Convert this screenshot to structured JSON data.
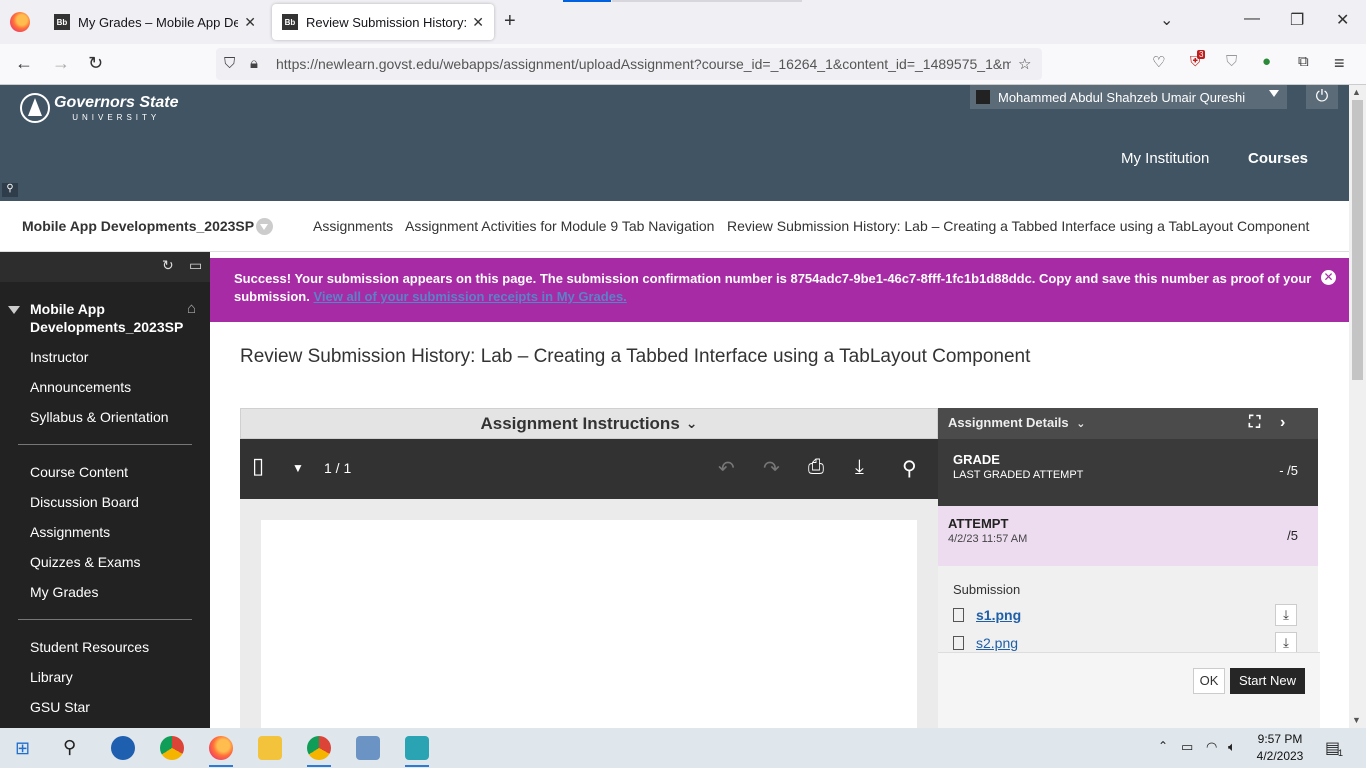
{
  "browser": {
    "tabs": [
      {
        "title": "My Grades – Mobile App Develo",
        "favicon": "Bb"
      },
      {
        "title": "Review Submission History: Lab",
        "favicon": "Bb"
      }
    ],
    "url": "https://newlearn.govst.edu/webapps/assignment/uploadAssignment?course_id=_16264_1&content_id=_1489575_1&m",
    "badge_count": "3"
  },
  "header": {
    "logo_name": "Governors State",
    "logo_sub": "UNIVERSITY",
    "user_name": "Mohammed Abdul Shahzeb Umair Qureshi",
    "nav": [
      "My Institution",
      "Courses"
    ]
  },
  "breadcrumbs": {
    "course": "Mobile App Developments_2023SP",
    "items": [
      "Assignments",
      "Assignment Activities for Module 9 Tab Navigation",
      "Review Submission History: Lab – Creating a Tabbed Interface using a TabLayout Component"
    ]
  },
  "sidebar": {
    "course_title_line1": "Mobile App",
    "course_title_line2": "Developments_2023SP",
    "group1": [
      "Instructor",
      "Announcements",
      "Syllabus & Orientation"
    ],
    "group2": [
      "Course Content",
      "Discussion Board",
      "Assignments",
      "Quizzes & Exams",
      "My Grades"
    ],
    "group3": [
      "Student Resources",
      "Library",
      "GSU Star"
    ]
  },
  "success": {
    "message": "Success! Your submission appears on this page. The submission confirmation number is 8754adc7-9be1-46c7-8fff-1fc1b1d88ddc. Copy and save this number as proof of your submission.",
    "link": "View all of your submission receipts in My Grades."
  },
  "page_title": "Review Submission History: Lab – Creating a Tabbed Interface using a TabLayout Component",
  "instructions": {
    "heading": "Assignment Instructions",
    "page_indicator": "1 / 1"
  },
  "details": {
    "heading": "Assignment Details",
    "grade_label": "GRADE",
    "grade_sub": "LAST GRADED ATTEMPT",
    "grade_value": "- /5",
    "attempt_label": "ATTEMPT",
    "attempt_date": "4/2/23 11:57 AM",
    "attempt_value": "/5",
    "submission_label": "Submission",
    "files": [
      "s1.png",
      "s2.png"
    ]
  },
  "actions": {
    "ok": "OK",
    "start_new": "Start New"
  },
  "taskbar": {
    "time": "9:57 PM",
    "date": "4/2/2023",
    "notif_count": "1"
  },
  "colors": {
    "header": "#415464",
    "success": "#a62ba4",
    "sidebar": "#222222",
    "attempt_bg": "#eddcf0"
  }
}
